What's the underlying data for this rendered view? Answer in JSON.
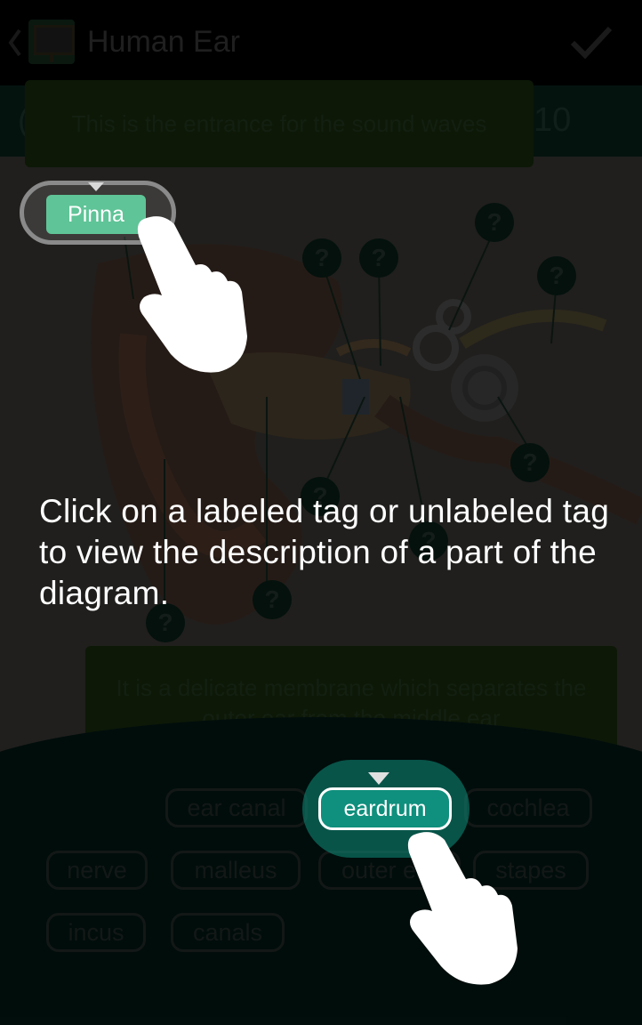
{
  "header": {
    "title": "Human Ear",
    "back_icon": "chevron-left-icon",
    "app_icon": "board-icon",
    "done_icon": "checkmark-icon"
  },
  "subbar": {
    "left_char": "(",
    "counter": "10"
  },
  "hints": {
    "top": "This is the entrance for the sound waves",
    "bottom": "It is a delicate membrane which separates the outer ear from the middle ear"
  },
  "diagram": {
    "question_mark": "?"
  },
  "highlighted_tags": {
    "pinna": "Pinna",
    "eardrum": "eardrum"
  },
  "instruction": "Click on a labeled tag or unlabeled tag to view the description of a part of the diagram.",
  "tags": {
    "ear_canal": "ear canal",
    "cochlea": "cochlea",
    "nerve": "nerve",
    "malleus": "malleus",
    "outer_ear": "outer ear",
    "stapes": "stapes",
    "incus": "incus",
    "canals": "canals"
  },
  "colors": {
    "accent_green": "#5fc497",
    "accent_teal": "#0f8f7d",
    "panel": "#03211c"
  }
}
